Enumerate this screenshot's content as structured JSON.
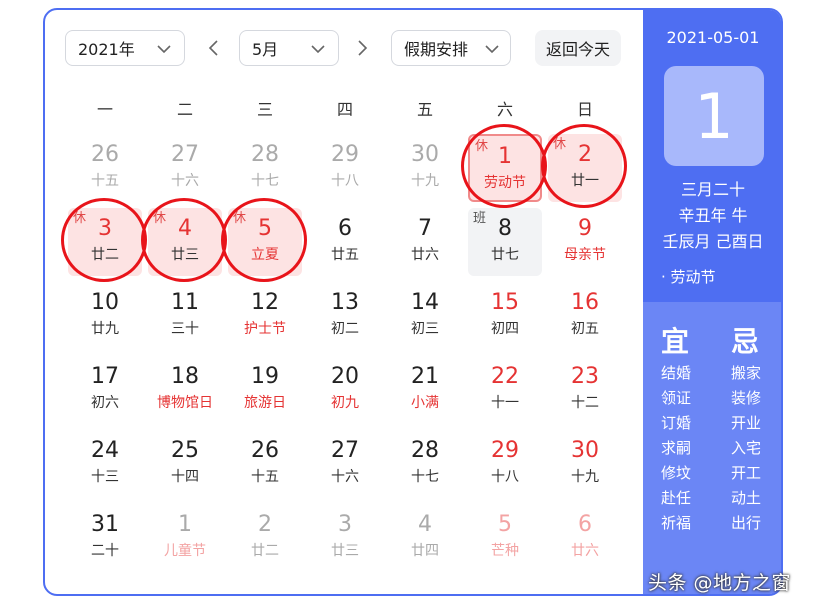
{
  "toolbar": {
    "year": "2021年",
    "month": "5月",
    "holiday": "假期安排",
    "today": "返回今天"
  },
  "weekdays": [
    "一",
    "二",
    "三",
    "四",
    "五",
    "六",
    "日"
  ],
  "days": [
    {
      "n": "26",
      "s": "十五",
      "muted": true
    },
    {
      "n": "27",
      "s": "十六",
      "muted": true
    },
    {
      "n": "28",
      "s": "十七",
      "muted": true
    },
    {
      "n": "29",
      "s": "十八",
      "muted": true
    },
    {
      "n": "30",
      "s": "十九",
      "muted": true
    },
    {
      "n": "1",
      "s": "劳动节",
      "tag": "休",
      "type": "holiday",
      "red": true,
      "subred": true,
      "selected": true,
      "ring": true
    },
    {
      "n": "2",
      "s": "廿一",
      "tag": "休",
      "type": "holiday",
      "red": true,
      "ring": true
    },
    {
      "n": "3",
      "s": "廿二",
      "tag": "休",
      "type": "holiday",
      "red": true,
      "ring": true
    },
    {
      "n": "4",
      "s": "廿三",
      "tag": "休",
      "type": "holiday",
      "red": true,
      "ring": true
    },
    {
      "n": "5",
      "s": "立夏",
      "tag": "休",
      "type": "holiday",
      "red": true,
      "subred": true,
      "ring": true
    },
    {
      "n": "6",
      "s": "廿五"
    },
    {
      "n": "7",
      "s": "廿六"
    },
    {
      "n": "8",
      "s": "廿七",
      "tag": "班",
      "type": "work"
    },
    {
      "n": "9",
      "s": "母亲节",
      "red": true,
      "subred": true
    },
    {
      "n": "10",
      "s": "廿九"
    },
    {
      "n": "11",
      "s": "三十"
    },
    {
      "n": "12",
      "s": "护士节",
      "subred": true
    },
    {
      "n": "13",
      "s": "初二"
    },
    {
      "n": "14",
      "s": "初三"
    },
    {
      "n": "15",
      "s": "初四",
      "red": true
    },
    {
      "n": "16",
      "s": "初五",
      "red": true
    },
    {
      "n": "17",
      "s": "初六"
    },
    {
      "n": "18",
      "s": "博物馆日",
      "subred": true
    },
    {
      "n": "19",
      "s": "旅游日",
      "subred": true
    },
    {
      "n": "20",
      "s": "初九",
      "subred": true
    },
    {
      "n": "21",
      "s": "小满",
      "subred": true
    },
    {
      "n": "22",
      "s": "十一",
      "red": true
    },
    {
      "n": "23",
      "s": "十二",
      "red": true
    },
    {
      "n": "24",
      "s": "十三"
    },
    {
      "n": "25",
      "s": "十四"
    },
    {
      "n": "26",
      "s": "十五"
    },
    {
      "n": "27",
      "s": "十六"
    },
    {
      "n": "28",
      "s": "十七"
    },
    {
      "n": "29",
      "s": "十八",
      "red": true
    },
    {
      "n": "30",
      "s": "十九",
      "red": true
    },
    {
      "n": "31",
      "s": "二十"
    },
    {
      "n": "1",
      "s": "儿童节",
      "muted": true,
      "mutedred": true
    },
    {
      "n": "2",
      "s": "廿二",
      "muted": true
    },
    {
      "n": "3",
      "s": "廿三",
      "muted": true
    },
    {
      "n": "4",
      "s": "廿四",
      "muted": true
    },
    {
      "n": "5",
      "s": "芒种",
      "muted": true,
      "mutedred": true,
      "nummutedred": true
    },
    {
      "n": "6",
      "s": "廿六",
      "muted": true,
      "mutedred": true,
      "nummutedred": true
    }
  ],
  "panel": {
    "date": "2021-05-01",
    "day": "1",
    "lunar": "三月二十",
    "year_gz": "辛丑年 牛",
    "month_day_gz": "壬辰月 己酉日",
    "festival": "· 劳动节",
    "yi_label": "宜",
    "ji_label": "忌",
    "yi": [
      "结婚",
      "领证",
      "订婚",
      "求嗣",
      "修坟",
      "赴任",
      "祈福"
    ],
    "ji": [
      "搬家",
      "装修",
      "开业",
      "入宅",
      "开工",
      "动土",
      "出行"
    ]
  },
  "watermark": "头条 @地方之窗",
  "colors": {
    "accent": "#4e6ef2",
    "holiday_bg": "#fde3e3",
    "red": "#e8141a",
    "ring": "#e8141a"
  }
}
